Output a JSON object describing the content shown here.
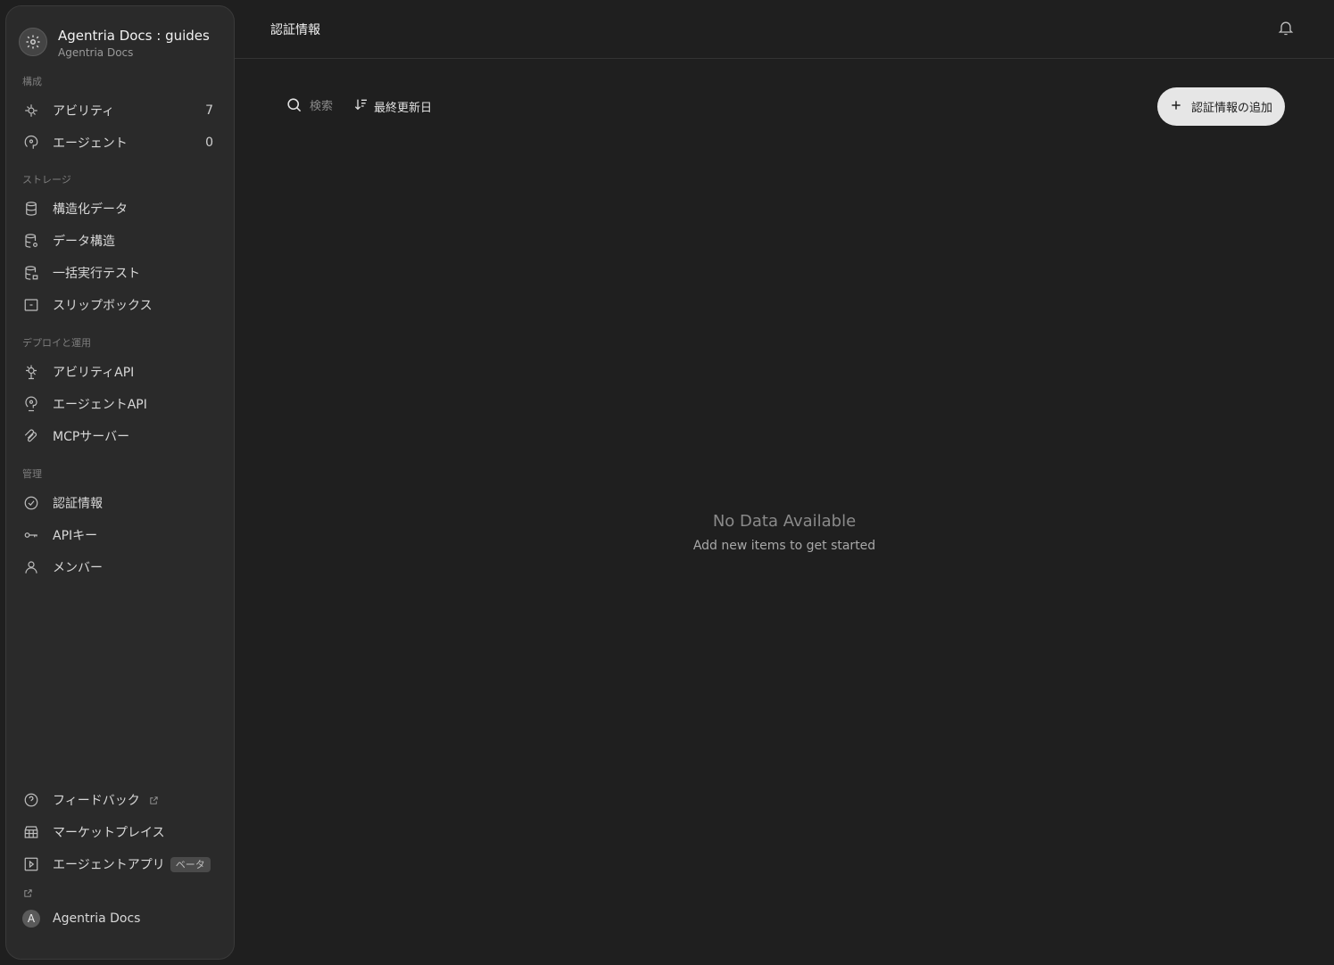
{
  "workspace": {
    "title": "Agentria Docs : guides",
    "subtitle": "Agentria Docs",
    "icon": "gear-icon"
  },
  "sidebar": {
    "sections": [
      {
        "label": "構成"
      },
      {
        "label": "ストレージ"
      },
      {
        "label": "デプロイと運用"
      },
      {
        "label": "管理"
      }
    ],
    "items": [
      {
        "label": "アビリティ",
        "count": "7",
        "icon": "ability-icon"
      },
      {
        "label": "エージェント",
        "count": "0",
        "icon": "agent-icon"
      },
      {
        "label": "構造化データ",
        "icon": "database-icon"
      },
      {
        "label": "データ構造",
        "icon": "database-schema-icon"
      },
      {
        "label": "一括実行テスト",
        "icon": "batch-test-icon"
      },
      {
        "label": "スリップボックス",
        "icon": "slipbox-icon"
      },
      {
        "label": "アビリティAPI",
        "icon": "ability-api-icon"
      },
      {
        "label": "エージェントAPI",
        "icon": "agent-api-icon"
      },
      {
        "label": "MCPサーバー",
        "icon": "mcp-icon"
      },
      {
        "label": "認証情報",
        "icon": "credential-icon"
      },
      {
        "label": "APIキー",
        "icon": "key-icon"
      },
      {
        "label": "メンバー",
        "icon": "user-icon"
      }
    ],
    "footer": [
      {
        "label": "フィードバック",
        "icon": "help-circle-icon"
      },
      {
        "label": "マーケットプレイス",
        "icon": "store-icon"
      },
      {
        "label": "エージェントアプリ",
        "badge": "ベータ",
        "icon": "play-square-icon"
      }
    ],
    "user": {
      "initial": "A",
      "name": "Agentria Docs"
    }
  },
  "header": {
    "title": "認証情報",
    "icon": "bell-icon"
  },
  "toolbar": {
    "search_placeholder": "検索",
    "sort_label": "最終更新日"
  },
  "add_button": {
    "label": "認証情報の追加"
  },
  "empty_state": {
    "title": "No Data Available",
    "subtitle": "Add new items to get started"
  },
  "colors": {
    "background": "#1f1f1f",
    "sidebar": "#2a2a2a",
    "button": "#e6e6e6"
  }
}
